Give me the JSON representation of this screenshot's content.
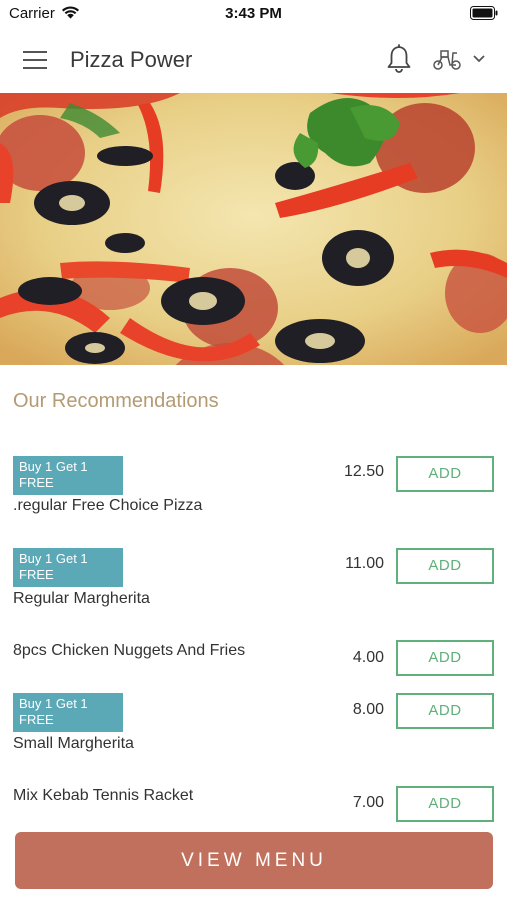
{
  "status_bar": {
    "carrier": "Carrier",
    "time": "3:43 PM"
  },
  "header": {
    "title": "Pizza Power",
    "icons": [
      "menu-icon",
      "bell-icon",
      "scooter-icon",
      "chevron-down-icon"
    ]
  },
  "hero": {
    "image": "pizza-photo"
  },
  "section": {
    "title": "Our Recommendations"
  },
  "items": [
    {
      "badge": "Buy 1 Get 1 FREE",
      "name": ".regular Free Choice Pizza",
      "price": "12.50",
      "action": "ADD"
    },
    {
      "badge": "Buy 1 Get 1 FREE",
      "name": "Regular Margherita",
      "price": "11.00",
      "action": "ADD"
    },
    {
      "badge": "",
      "name": "8pcs Chicken Nuggets And Fries",
      "price": "4.00",
      "action": "ADD"
    },
    {
      "badge": "Buy 1 Get 1 FREE",
      "name": "Small Margherita",
      "price": "8.00",
      "action": "ADD"
    },
    {
      "badge": "",
      "name": "Mix Kebab Tennis Racket",
      "price": "7.00",
      "action": "ADD"
    }
  ],
  "footer": {
    "view_menu_label": "VIEW MENU"
  },
  "colors": {
    "badge": "#5ba8b7",
    "add_button": "#5fb07a",
    "view_menu": "#c0705c",
    "section_title": "#b39b74"
  }
}
